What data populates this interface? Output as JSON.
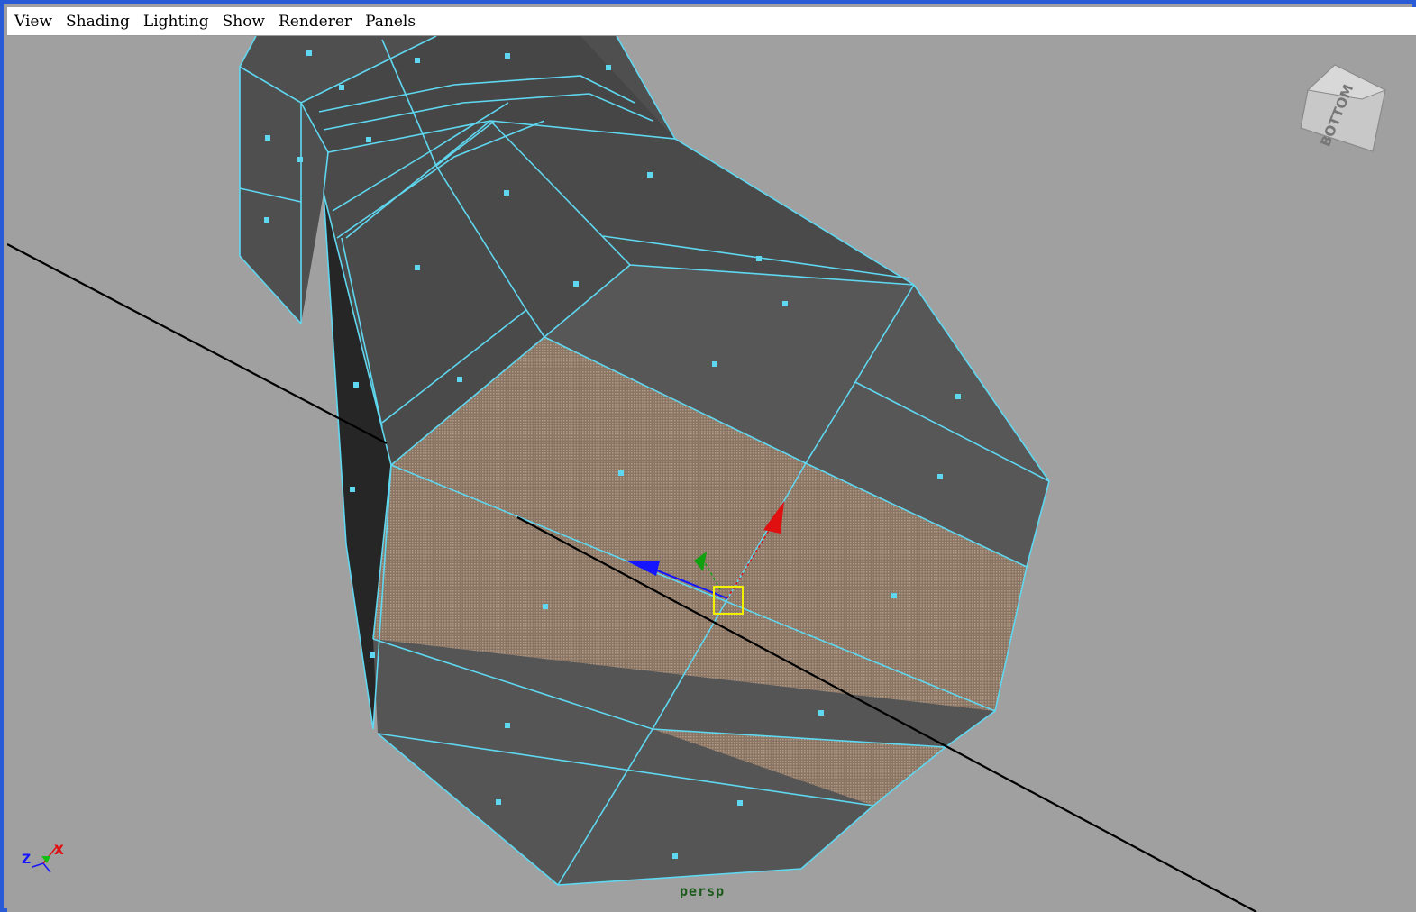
{
  "menubar": {
    "items": [
      "View",
      "Shading",
      "Lighting",
      "Show",
      "Renderer",
      "Panels"
    ]
  },
  "viewport": {
    "camera_label": "persp",
    "viewcube_label": "BOTTOM",
    "axis_labels": {
      "z": "Z",
      "x": "X"
    },
    "background_color": "#a0a0a0",
    "wireframe_color": "#5fd7f0",
    "face_color": "#555555",
    "selected_face_color": "#8c7868"
  }
}
